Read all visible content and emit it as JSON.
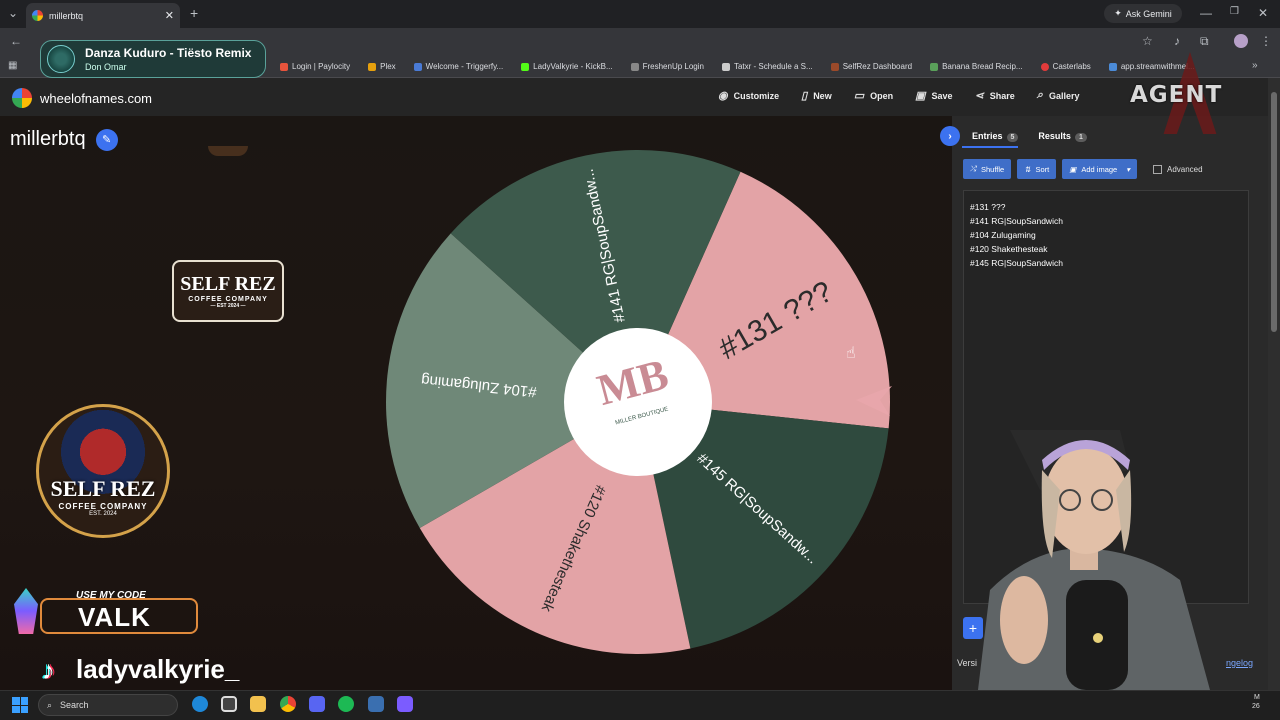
{
  "browser": {
    "tab_title": "millerbtq",
    "ask_gemini": "Ask Gemini",
    "bookmarks": [
      "Login | Paylocity",
      "Plex",
      "Welcome - Triggerfy...",
      "LadyValkyrie - KickB...",
      "FreshenUp Login",
      "Tatxr - Schedule a S...",
      "SelfRez Dashboard",
      "Banana Bread Recip...",
      "Casterlabs",
      "app.streamwithmel..."
    ]
  },
  "now_playing": {
    "song": "Danza Kuduro - Tiësto Remix",
    "artist": "Don Omar"
  },
  "app": {
    "site": "wheelofnames.com",
    "actions": [
      "Customize",
      "New",
      "Open",
      "Save",
      "Share",
      "Gallery"
    ],
    "wheel_title": "millerbtq"
  },
  "wheel": {
    "center_logo_text": "MB",
    "center_logo_sub": "MILLER BOUTIQUE",
    "segments": [
      {
        "label": "#131 ???",
        "color": "#e3a3a6"
      },
      {
        "label": "#145 RG|SoupSandw...",
        "color": "#2f4a3e"
      },
      {
        "label": "#120 Shakethesteak",
        "color": "#e3a3a6"
      },
      {
        "label": "#104 Zulugaming",
        "color": "#6f8878"
      },
      {
        "label": "#141 RG|SoupSandw...",
        "color": "#3d5a4c"
      }
    ]
  },
  "panel": {
    "tab_entries": "Entries",
    "entries_count": "5",
    "tab_results": "Results",
    "results_count": "1",
    "shuffle": "Shuffle",
    "sort": "Sort",
    "add_image": "Add image",
    "advanced": "Advanced",
    "entries": [
      "#131 ???",
      "#141 RG|SoupSandwich",
      "#104 Zulugaming",
      "#120 Shakethesteak",
      "#145 RG|SoupSandwich"
    ],
    "version": "Versi",
    "changelog": "ngelog"
  },
  "overlays": {
    "logo1_big": "SELF REZ",
    "logo1_small": "COFFEE COMPANY",
    "logo1_est": "— EST 2024 —",
    "logo2_big": "SELF REZ",
    "logo2_small": "COFFEE COMPANY",
    "logo2_est": "EST. 2024",
    "code_label": "USE MY CODE",
    "code_value": "VALK",
    "tiktok_handle": "ladyvalkyrie_",
    "watermark": "AGENT"
  },
  "taskbar": {
    "search": "Search",
    "clock_top": "M",
    "clock_bottom": "26"
  }
}
